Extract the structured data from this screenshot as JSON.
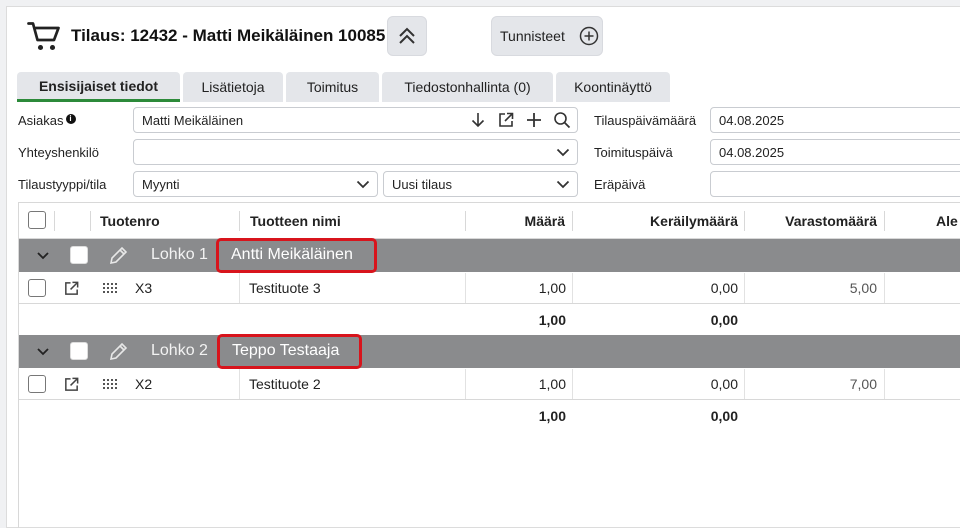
{
  "header": {
    "title": "Tilaus: 12432 - Matti Meikäläinen 10085",
    "tags_label": "Tunnisteet"
  },
  "tabs": [
    {
      "label": "Ensisijaiset tiedot",
      "active": true
    },
    {
      "label": "Lisätietoja"
    },
    {
      "label": "Toimitus"
    },
    {
      "label": "Tiedostonhallinta (0)"
    },
    {
      "label": "Koontinäyttö"
    }
  ],
  "form": {
    "customer_label": "Asiakas",
    "customer_value": "Matti Meikäläinen",
    "contact_label": "Yhteyshenkilö",
    "contact_value": "",
    "ordertype_label": "Tilaustyyppi/tila",
    "ordertype_value": "Myynti",
    "status_value": "Uusi tilaus",
    "orderdate_label": "Tilauspäivämäärä",
    "orderdate_value": "04.08.2025",
    "deliverydate_label": "Toimituspäivä",
    "deliverydate_value": "04.08.2025",
    "duedate_label": "Eräpäivä",
    "duedate_value": ""
  },
  "grid": {
    "columns": [
      "Tuotenro",
      "Tuotteen nimi",
      "Määrä",
      "Keräilymäärä",
      "Varastomäärä",
      "Ale"
    ],
    "groups": [
      {
        "label": "Lohko 1",
        "name": "Antti Meikäläinen",
        "rows": [
          {
            "product_no": "X3",
            "product_name": "Testituote 3",
            "qty": "1,00",
            "picked": "0,00",
            "stock": "5,00"
          }
        ],
        "totals": {
          "qty": "1,00",
          "picked": "0,00"
        }
      },
      {
        "label": "Lohko 2",
        "name": "Teppo Testaaja",
        "rows": [
          {
            "product_no": "X2",
            "product_name": "Testituote 2",
            "qty": "1,00",
            "picked": "0,00",
            "stock": "7,00"
          }
        ],
        "totals": {
          "qty": "1,00",
          "picked": "0,00"
        }
      }
    ]
  },
  "colors": {
    "accent_tab": "#2c8a3a",
    "group_bg": "#8a8b8d",
    "highlight": "#d8141c"
  },
  "icons": [
    "shopping-cart-icon",
    "chevrons-up-icon",
    "plus-circle-icon",
    "info-icon",
    "arrow-down-icon",
    "external-link-icon",
    "plus-icon",
    "search-icon",
    "chevron-down-icon",
    "pencil-icon",
    "drag-handle-icon"
  ]
}
